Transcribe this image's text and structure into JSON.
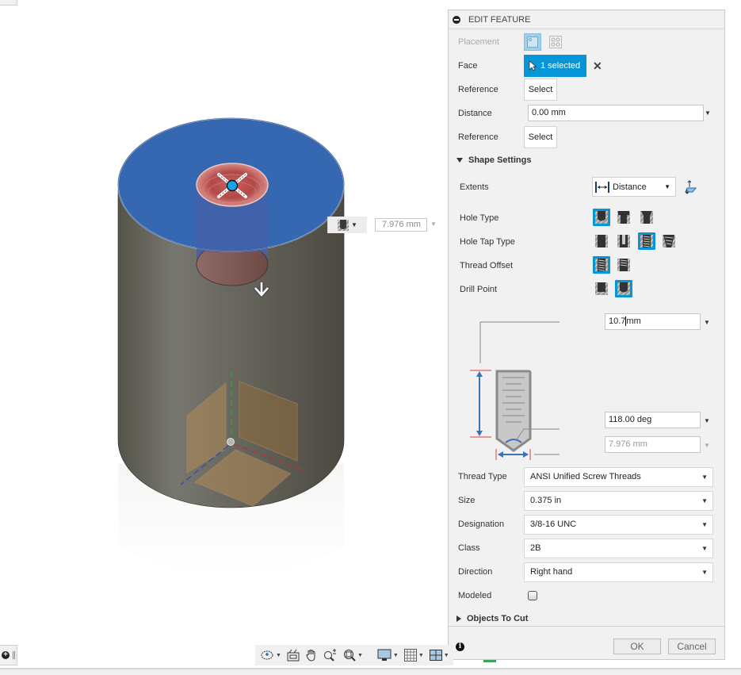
{
  "viewport": {
    "hole_type_menu_icon": "hole-simple-icon",
    "diameter_readout": "7.976 mm",
    "direction_arrow": "arrow-down-icon"
  },
  "panel": {
    "title": "EDIT FEATURE",
    "placement": {
      "label": "Placement",
      "options": [
        {
          "name": "single-hole",
          "selected": true
        },
        {
          "name": "multiple-holes",
          "selected": false
        }
      ]
    },
    "face": {
      "label": "Face",
      "value": "1 selected"
    },
    "reference1": {
      "label": "Reference",
      "button": "Select"
    },
    "distance": {
      "label": "Distance",
      "value": "0.00 mm"
    },
    "reference2": {
      "label": "Reference",
      "button": "Select"
    },
    "shape_settings": {
      "title": "Shape Settings",
      "extents": {
        "label": "Extents",
        "value": "Distance"
      },
      "hole_type": {
        "label": "Hole Type",
        "options": [
          "simple",
          "counterbore",
          "countersink"
        ],
        "selected": 0
      },
      "hole_tap_type": {
        "label": "Hole Tap Type",
        "options": [
          "simple",
          "clearance",
          "tapped",
          "taper-tapped"
        ],
        "selected": 2
      },
      "thread_offset": {
        "label": "Thread Offset",
        "options": [
          "full",
          "offset"
        ],
        "selected": 0
      },
      "drill_point": {
        "label": "Drill Point",
        "options": [
          "flat",
          "angle"
        ],
        "selected": 1
      },
      "depth": "10.7 mm",
      "depth_typed": "10.7",
      "depth_unit": "mm",
      "drill_angle": "118.00 deg",
      "diameter": "7.976 mm"
    },
    "thread": {
      "thread_type": {
        "label": "Thread Type",
        "value": "ANSI Unified Screw Threads"
      },
      "size": {
        "label": "Size",
        "value": "0.375 in"
      },
      "designation": {
        "label": "Designation",
        "value": "3/8-16 UNC"
      },
      "class": {
        "label": "Class",
        "value": "2B"
      },
      "direction": {
        "label": "Direction",
        "value": "Right hand"
      },
      "modeled": {
        "label": "Modeled",
        "checked": false
      }
    },
    "objects_to_cut": {
      "title": "Objects To Cut"
    },
    "ok_label": "OK",
    "cancel_label": "Cancel"
  },
  "colors": {
    "accent": "#0696d7",
    "selected_face": "#3568b0",
    "hole": "#b84c4c",
    "body": "#6b6a60"
  }
}
